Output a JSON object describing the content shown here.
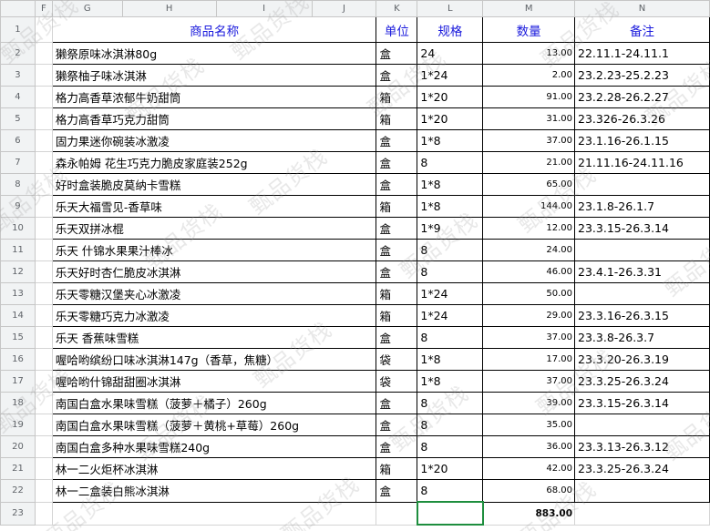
{
  "columns": [
    "F",
    "G",
    "H",
    "I",
    "J",
    "K",
    "L",
    "M",
    "N"
  ],
  "headers": {
    "name": "商品名称",
    "unit": "单位",
    "spec": "规格",
    "qty": "数量",
    "note": "备注"
  },
  "rows": [
    {
      "num": "2",
      "name": "獭祭原味冰淇淋80g",
      "unit": "盒",
      "spec": "24",
      "qty": "13.00",
      "note": "22.11.1-24.11.1"
    },
    {
      "num": "3",
      "name": "獭祭柚子味冰淇淋",
      "unit": "盒",
      "spec": "1*24",
      "qty": "2.00",
      "note": "23.2.23-25.2.23"
    },
    {
      "num": "4",
      "name": "格力高香草浓郁牛奶甜筒",
      "unit": "箱",
      "spec": "1*20",
      "qty": "91.00",
      "note": "23.2.28-26.2.27"
    },
    {
      "num": "5",
      "name": "格力高香草巧克力甜筒",
      "unit": "箱",
      "spec": "1*20",
      "qty": "31.00",
      "note": "23.326-26.3.26"
    },
    {
      "num": "6",
      "name": "固力果迷你碗装冰激凌",
      "unit": "盒",
      "spec": "1*8",
      "qty": "37.00",
      "note": "23.1.16-26.1.15"
    },
    {
      "num": "7",
      "name": "森永帕姆 花生巧克力脆皮家庭装252g",
      "unit": "盒",
      "spec": "8",
      "qty": "21.00",
      "note": "21.11.16-24.11.16"
    },
    {
      "num": "8",
      "name": "好时盒装脆皮莫纳卡雪糕",
      "unit": "盒",
      "spec": "1*8",
      "qty": "65.00",
      "note": ""
    },
    {
      "num": "9",
      "name": "乐天大福雪见-香草味",
      "unit": "箱",
      "spec": "1*8",
      "qty": "144.00",
      "note": "23.1.8-26.1.7"
    },
    {
      "num": "10",
      "name": "乐天双拼冰棍",
      "unit": "盒",
      "spec": "1*9",
      "qty": "12.00",
      "note": "23.3.15-26.3.14"
    },
    {
      "num": "11",
      "name": "乐天 什锦水果果汁棒冰",
      "unit": "盒",
      "spec": "8",
      "qty": "24.00",
      "note": ""
    },
    {
      "num": "12",
      "name": "乐天好时杏仁脆皮冰淇淋",
      "unit": "盒",
      "spec": "8",
      "qty": "46.00",
      "note": "23.4.1-26.3.31"
    },
    {
      "num": "13",
      "name": "乐天零糖汉堡夹心冰激凌",
      "unit": "箱",
      "spec": "1*24",
      "qty": "50.00",
      "note": ""
    },
    {
      "num": "14",
      "name": "乐天零糖巧克力冰激凌",
      "unit": "箱",
      "spec": "1*24",
      "qty": "29.00",
      "note": "23.3.16-26.3.15"
    },
    {
      "num": "15",
      "name": "乐天 香蕉味雪糕",
      "unit": "盒",
      "spec": "8",
      "qty": "37.00",
      "note": "23.3.8-26.3.7"
    },
    {
      "num": "16",
      "name": "喔哈哟缤纷口味冰淇淋147g（香草，焦糖）",
      "unit": "袋",
      "spec": "1*8",
      "qty": "17.00",
      "note": "23.3.20-26.3.19"
    },
    {
      "num": "17",
      "name": "喔哈哟什锦甜甜圈冰淇淋",
      "unit": "袋",
      "spec": "1*8",
      "qty": "37.00",
      "note": "23.3.25-26.3.24"
    },
    {
      "num": "18",
      "name": "南国白盒水果味雪糕（菠萝＋橘子）260g",
      "unit": "盒",
      "spec": "8",
      "qty": "39.00",
      "note": "23.3.15-26.3.14"
    },
    {
      "num": "19",
      "name": "南国白盒水果味雪糕（菠萝＋黄桃+草莓）260g",
      "unit": "盒",
      "spec": "8",
      "qty": "35.00",
      "note": ""
    },
    {
      "num": "20",
      "name": "南国白盒多种水果味雪糕240g",
      "unit": "盒",
      "spec": "8",
      "qty": "36.00",
      "note": "23.3.13-26.3.12"
    },
    {
      "num": "21",
      "name": "林一二火炬杯冰淇淋",
      "unit": "箱",
      "spec": "1*20",
      "qty": "42.00",
      "note": "23.3.25-26.3.24"
    },
    {
      "num": "22",
      "name": "林一二盒装白熊冰淇淋",
      "unit": "盒",
      "spec": "8",
      "qty": "68.00",
      "note": ""
    }
  ],
  "total_row": {
    "num": "23",
    "qty": "883.00"
  },
  "watermark": "甄品货栈",
  "colors": {
    "header_text": "#1a1adc",
    "selection": "#1e8e3e"
  }
}
